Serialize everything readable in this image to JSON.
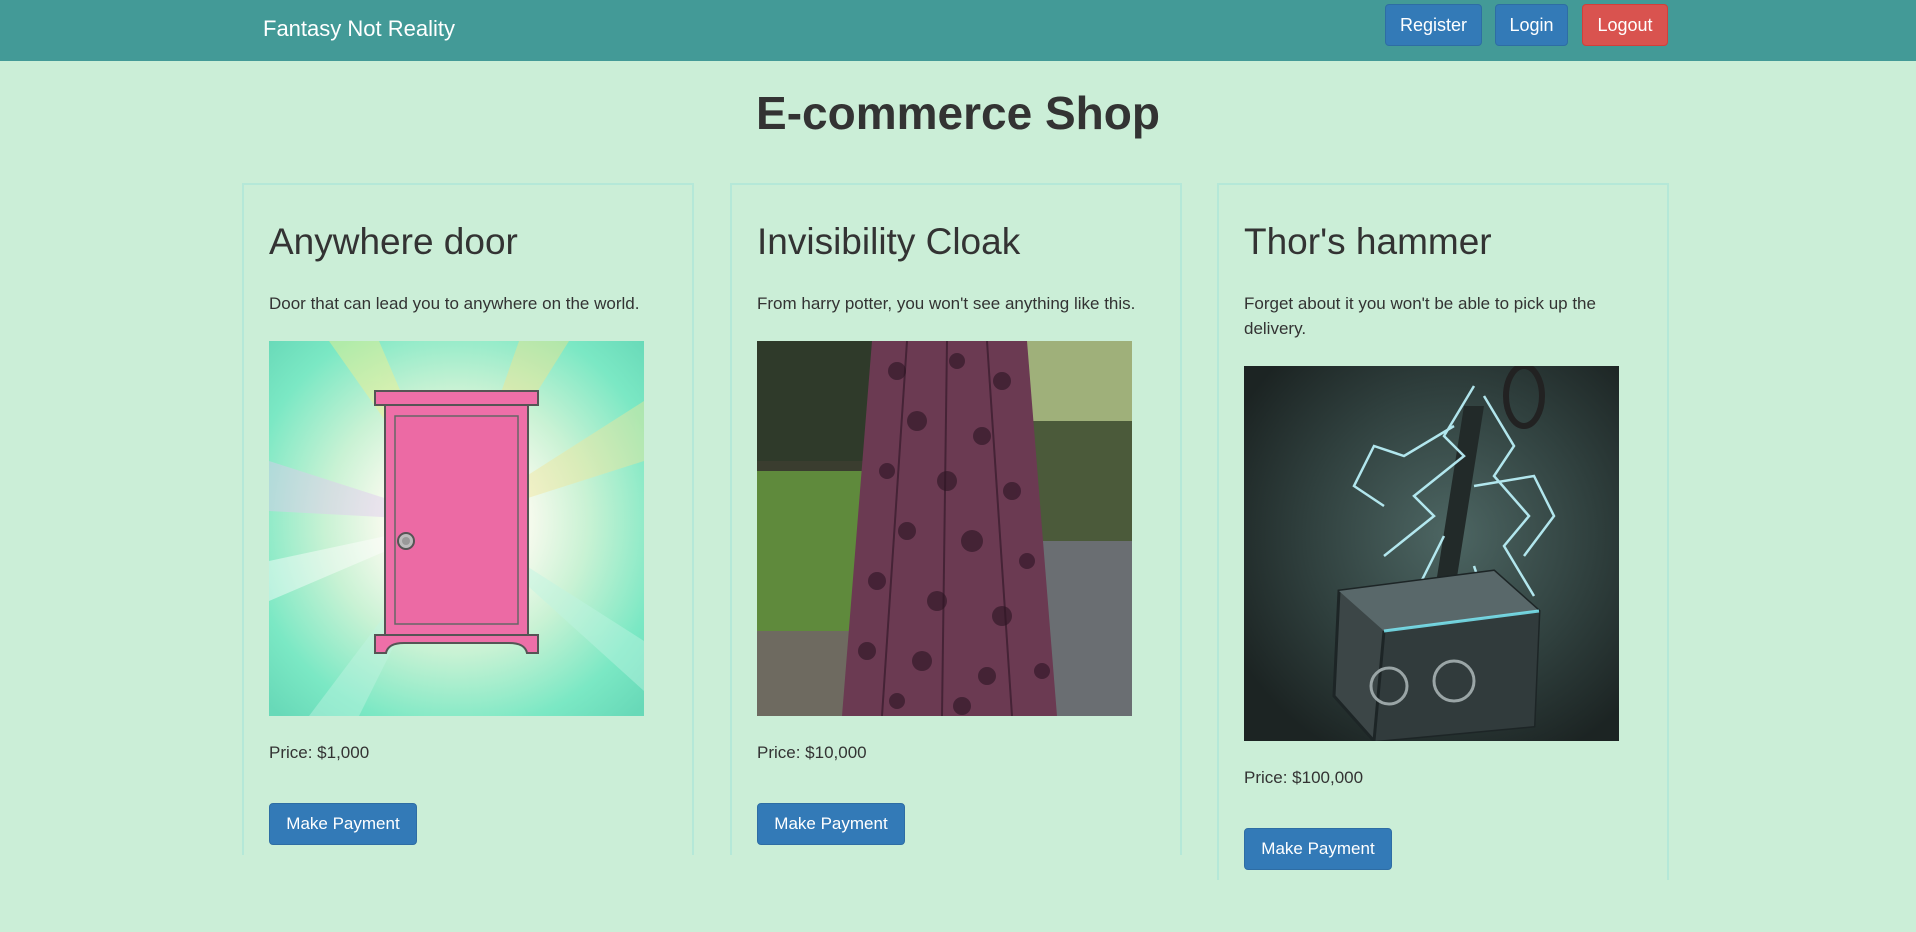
{
  "navbar": {
    "brand": "Fantasy Not Reality",
    "register_label": "Register",
    "login_label": "Login",
    "logout_label": "Logout"
  },
  "page": {
    "title": "E-commerce Shop"
  },
  "products": [
    {
      "name": "Anywhere door",
      "description": "Door that can lead you to anywhere on the world.",
      "price": "Price: $1,000",
      "button_label": "Make Payment",
      "image_icon": "pink-door-image"
    },
    {
      "name": "Invisibility Cloak",
      "description": "From harry potter, you won't see anything like this.",
      "price": "Price: $10,000",
      "button_label": "Make Payment",
      "image_icon": "floral-cloak-image"
    },
    {
      "name": "Thor's hammer",
      "description": "Forget about it you won't be able to pick up the delivery.",
      "price": "Price: $100,000",
      "button_label": "Make Payment",
      "image_icon": "lightning-hammer-image"
    }
  ],
  "colors": {
    "background": "#cbeed7",
    "navbar": "#439a97",
    "primary": "#337ab7",
    "danger": "#d9534f"
  }
}
